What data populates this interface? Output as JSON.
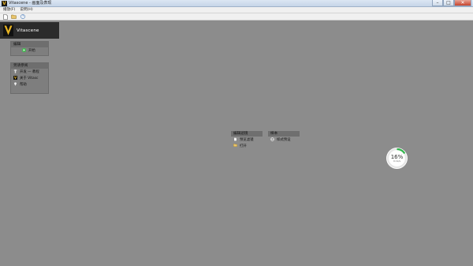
{
  "window": {
    "title": "Vitascene - 画面及表现"
  },
  "menu": {
    "items": [
      "播放(F)",
      "说明(H)"
    ]
  },
  "toolbar": {
    "icons": [
      "new-file-icon",
      "open-folder-icon",
      "help-icon"
    ]
  },
  "brand": {
    "name": "Vitascene",
    "accent": "#e8b422"
  },
  "edit_panel": {
    "header": "编辑",
    "button_label": "开始"
  },
  "options_panel": {
    "header": "另请参阅",
    "items": [
      {
        "label": "开发 — 教程",
        "icon": "info-icon"
      },
      {
        "label": "关于 Vitasc",
        "icon": "vitascene-icon"
      },
      {
        "label": "帮助",
        "icon": "pin-icon"
      }
    ]
  },
  "filter_box": {
    "header": "编辑滤镜",
    "item_label": "预览滤镜",
    "open_label": "打开"
  },
  "preset_box": {
    "header": "样本",
    "item_label": "样式预设"
  },
  "gauge": {
    "value": "16%",
    "sub": "0.1k/s",
    "percent": 16,
    "color": "#2fb54a"
  }
}
